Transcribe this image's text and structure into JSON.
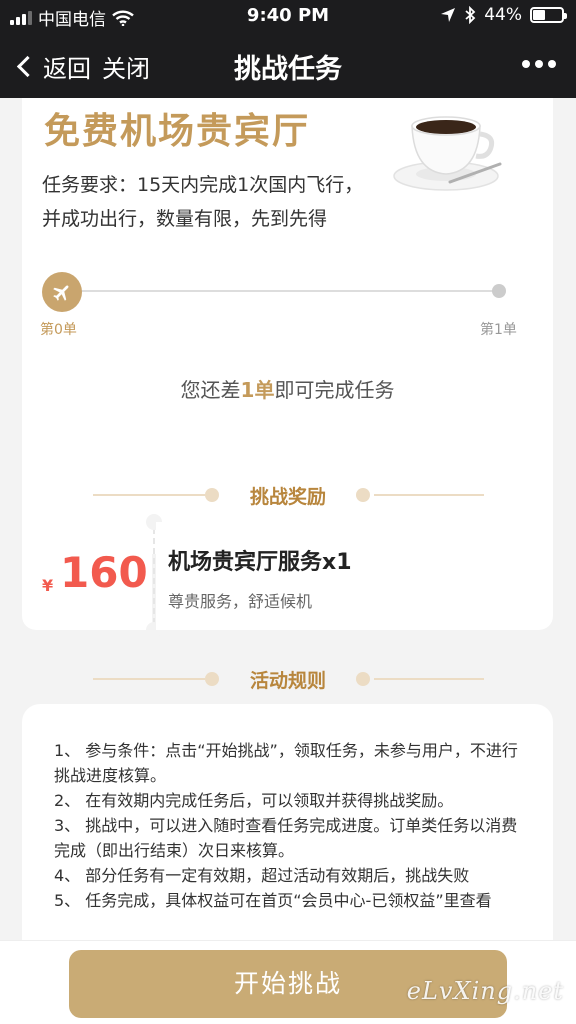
{
  "status_bar": {
    "carrier": "中国电信",
    "time": "9:40 PM",
    "battery_text": "44%",
    "battery_level": 0.44
  },
  "nav": {
    "back_label": "返回",
    "close_label": "关闭",
    "title": "挑战任务"
  },
  "task": {
    "title": "免费机场贵宾厅",
    "description": "任务要求：15天内完成1次国内飞行，并成功出行，数量有限，先到先得",
    "progress_start_label": "第0单",
    "progress_end_label": "第1单",
    "progress_fraction": 0,
    "remaining_prefix": "您还差",
    "remaining_count": "1单",
    "remaining_suffix": "即可完成任务"
  },
  "reward_section": {
    "title": "挑战奖励"
  },
  "reward": {
    "currency": "¥",
    "amount": "160",
    "name": "机场贵宾厅服务x1",
    "subtitle": "尊贵服务，舒适候机"
  },
  "rules_section": {
    "title": "活动规则"
  },
  "rules": [
    "1、 参与条件：点击“开始挑战”，领取任务，未参与用户，不进行挑战进度核算。",
    "2、 在有效期内完成任务后，可以领取并获得挑战奖励。",
    "3、 挑战中，可以进入随时查看任务完成进度。订单类任务以消费完成（即出行结束）次日来核算。",
    "4、 部分任务有一定有效期，超过活动有效期后，挑战失败",
    "5、 任务完成，具体权益可在首页“会员中心-已领权益”里查看"
  ],
  "bottom": {
    "start_button": "开始挑战",
    "watermark": "eLvXing.net"
  },
  "colors": {
    "accent_gold": "#c49a5a",
    "price_red": "#f25a4e",
    "bar_dark": "#1c1c1e"
  }
}
